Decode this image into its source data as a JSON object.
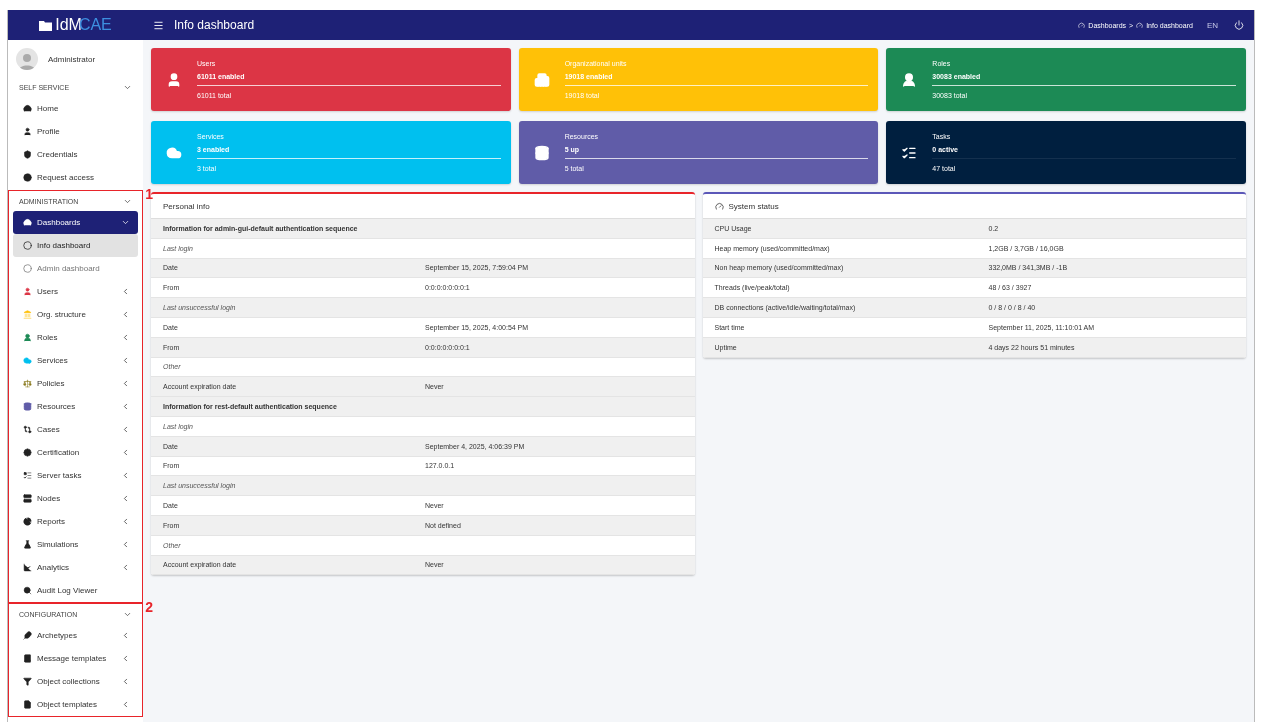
{
  "topbar": {
    "logo": {
      "first": "IdM",
      "second": "CAE"
    },
    "page_title": "Info dashboard",
    "breadcrumbs": [
      "Dashboards",
      "Info dashboard"
    ],
    "breadcrumb_separator": ">",
    "language": "EN"
  },
  "sidebar": {
    "user": "Administrator",
    "sections": [
      {
        "title": "SELF SERVICE",
        "expanded": true,
        "items": [
          {
            "label": "Home",
            "kind": "link",
            "selected": false
          },
          {
            "label": "Profile",
            "kind": "link",
            "selected": false
          },
          {
            "label": "Credentials",
            "kind": "link",
            "selected": false
          },
          {
            "label": "Request access",
            "kind": "link",
            "selected": false
          }
        ]
      },
      {
        "title": "ADMINISTRATION",
        "expanded": true,
        "annotation": "1",
        "items": [
          {
            "label": "Dashboards",
            "kind": "menu",
            "selected": true,
            "expanded": true,
            "children": [
              {
                "label": "Info dashboard",
                "selected": true
              },
              {
                "label": "Admin dashboard",
                "selected": false
              }
            ]
          },
          {
            "label": "Users",
            "kind": "menu",
            "selected": false,
            "expanded": false
          },
          {
            "label": "Org. structure",
            "kind": "menu",
            "selected": false,
            "expanded": false
          },
          {
            "label": "Roles",
            "kind": "menu",
            "selected": false,
            "expanded": false
          },
          {
            "label": "Services",
            "kind": "menu",
            "selected": false,
            "expanded": false
          },
          {
            "label": "Policies",
            "kind": "menu",
            "selected": false,
            "expanded": false
          },
          {
            "label": "Resources",
            "kind": "menu",
            "selected": false,
            "expanded": false
          },
          {
            "label": "Cases",
            "kind": "menu",
            "selected": false,
            "expanded": false
          },
          {
            "label": "Certification",
            "kind": "menu",
            "selected": false,
            "expanded": false
          },
          {
            "label": "Server tasks",
            "kind": "menu",
            "selected": false,
            "expanded": false
          },
          {
            "label": "Nodes",
            "kind": "menu",
            "selected": false,
            "expanded": false
          },
          {
            "label": "Reports",
            "kind": "menu",
            "selected": false,
            "expanded": false
          },
          {
            "label": "Simulations",
            "kind": "menu",
            "selected": false,
            "expanded": false
          },
          {
            "label": "Analytics",
            "kind": "menu",
            "selected": false,
            "expanded": false
          },
          {
            "label": "Audit Log Viewer",
            "kind": "link",
            "selected": false
          }
        ]
      },
      {
        "title": "CONFIGURATION",
        "expanded": true,
        "annotation": "2",
        "items": [
          {
            "label": "Archetypes",
            "kind": "menu",
            "selected": false,
            "expanded": false
          },
          {
            "label": "Message templates",
            "kind": "menu",
            "selected": false,
            "expanded": false
          },
          {
            "label": "Object collections",
            "kind": "menu",
            "selected": false,
            "expanded": false
          },
          {
            "label": "Object templates",
            "kind": "menu",
            "selected": false,
            "expanded": false
          }
        ]
      }
    ]
  },
  "stats": [
    {
      "title": "Users",
      "primary": "61011 enabled",
      "secondary": "61011 total",
      "color": "#dc3545",
      "level": 1
    },
    {
      "title": "Organizational units",
      "primary": "19018 enabled",
      "secondary": "19018 total",
      "color": "#ffc107",
      "level": 1
    },
    {
      "title": "Roles",
      "primary": "30083 enabled",
      "secondary": "30083 total",
      "color": "#1c8a55",
      "level": 1
    },
    {
      "title": "Services",
      "primary": "3 enabled",
      "secondary": "3 total",
      "color": "#00c0ef",
      "level": 1
    },
    {
      "title": "Resources",
      "primary": "5 up",
      "secondary": "5 total",
      "color": "#605ca8",
      "level": 1
    },
    {
      "title": "Tasks",
      "primary": "0 active",
      "secondary": "47 total",
      "color": "#001f3f",
      "level": 0
    }
  ],
  "personal_info": {
    "title": "Personal info",
    "sections": [
      {
        "heading": "Information for admin-gui-default authentication sequence",
        "rows": [
          {
            "kind": "subheading",
            "label": "Last login"
          },
          {
            "kind": "row",
            "label": "Date",
            "value": "September 15, 2025, 7:59:04 PM"
          },
          {
            "kind": "row",
            "label": "From",
            "value": "0:0:0:0:0:0:0:1"
          },
          {
            "kind": "subheading",
            "label": "Last unsuccessful login"
          },
          {
            "kind": "row",
            "label": "Date",
            "value": "September 15, 2025, 4:00:54 PM"
          },
          {
            "kind": "row",
            "label": "From",
            "value": "0:0:0:0:0:0:0:1"
          },
          {
            "kind": "subheading",
            "label": "Other"
          },
          {
            "kind": "row",
            "label": "Account expiration date",
            "value": "Never"
          }
        ]
      },
      {
        "heading": "Information for rest-default authentication sequence",
        "rows": [
          {
            "kind": "subheading",
            "label": "Last login"
          },
          {
            "kind": "row",
            "label": "Date",
            "value": "September 4, 2025, 4:06:39 PM"
          },
          {
            "kind": "row",
            "label": "From",
            "value": "127.0.0.1"
          },
          {
            "kind": "subheading",
            "label": "Last unsuccessful login"
          },
          {
            "kind": "row",
            "label": "Date",
            "value": "Never"
          },
          {
            "kind": "row",
            "label": "From",
            "value": "Not defined"
          },
          {
            "kind": "subheading",
            "label": "Other"
          },
          {
            "kind": "row",
            "label": "Account expiration date",
            "value": "Never"
          }
        ]
      }
    ]
  },
  "system_status": {
    "title": "System status",
    "rows": [
      {
        "label": "CPU Usage",
        "value": "0.2"
      },
      {
        "label": "Heap memory (used/committed/max)",
        "value": "1,2GB / 3,7GB / 16,0GB"
      },
      {
        "label": "Non heap memory (used/committed/max)",
        "value": "332,0MB / 341,3MB / -1B"
      },
      {
        "label": "Threads (live/peak/total)",
        "value": "48 / 63 / 3927"
      },
      {
        "label": "DB connections (active/idle/waiting/total/max)",
        "value": "0 / 8 / 0 / 8 / 40"
      },
      {
        "label": "Start time",
        "value": "September 11, 2025, 11:10:01 AM"
      },
      {
        "label": "Uptime",
        "value": "4 days 22 hours 51 minutes"
      }
    ]
  }
}
